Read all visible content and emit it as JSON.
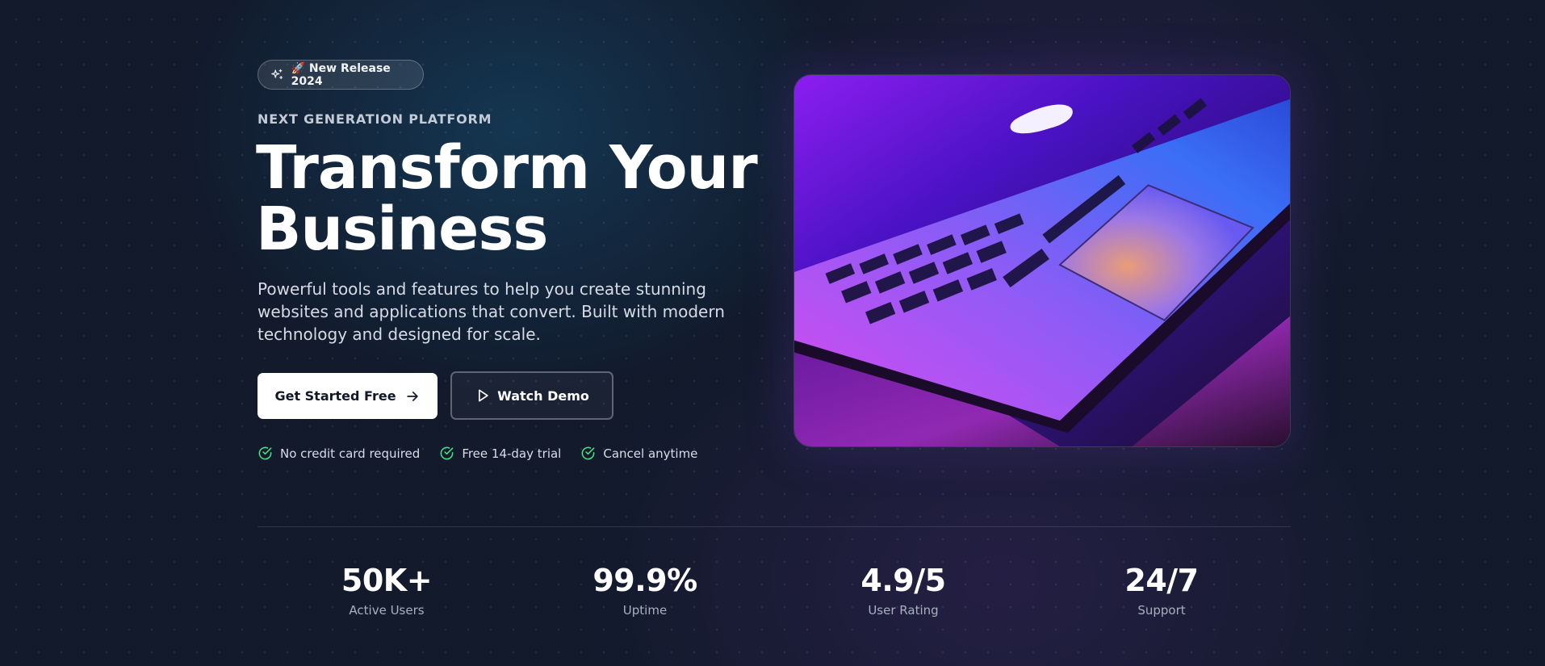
{
  "badge": {
    "label": "🚀 New Release 2024",
    "icon": "sparkles-icon"
  },
  "hero": {
    "eyebrow": "NEXT GENERATION PLATFORM",
    "headline_line1": "Transform Your",
    "headline_line2": "Business",
    "subtitle": "Powerful tools and features to help you create stunning websites and applications that convert. Built with modern technology and designed for scale.",
    "image_icon": "laptop-photo"
  },
  "buttons": {
    "primary_label": "Get Started Free",
    "primary_icon": "arrow-right-icon",
    "secondary_label": "Watch Demo",
    "secondary_icon": "play-icon"
  },
  "perks": [
    {
      "label": "No credit card required",
      "icon": "check-circle-icon"
    },
    {
      "label": "Free 14-day trial",
      "icon": "check-circle-icon"
    },
    {
      "label": "Cancel anytime",
      "icon": "check-circle-icon"
    }
  ],
  "stats": [
    {
      "value": "50K+",
      "label": "Active Users"
    },
    {
      "value": "99.9%",
      "label": "Uptime"
    },
    {
      "value": "4.9/5",
      "label": "User Rating"
    },
    {
      "value": "24/7",
      "label": "Support"
    }
  ],
  "colors": {
    "background": "#121a2c",
    "accent_check": "#4ade80",
    "primary_button": "#ffffff"
  }
}
